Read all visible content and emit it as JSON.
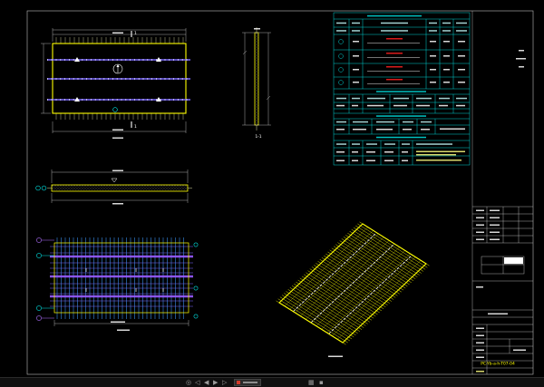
{
  "colors": {
    "background": "#000000",
    "outline": "#ffff00",
    "table": "#00e5e5",
    "rebar_purple": "#7d6bff",
    "rebar_blue": "#3f9cff",
    "accent_red": "#ff2020",
    "frame": "#bdbdbd",
    "text": "#ffffff"
  },
  "plan_view": {
    "section_mark_top": "1",
    "section_mark_bottom": "1"
  },
  "side_section": {
    "label": "1-1"
  },
  "title_block": {
    "drawing_code": "PC-Yb-a-h-T07-04"
  },
  "statusbar": {
    "icons": [
      {
        "name": "target-icon",
        "glyph": "◎"
      },
      {
        "name": "first-layout-icon",
        "glyph": "◁"
      },
      {
        "name": "previous-layout-icon",
        "glyph": "◀"
      },
      {
        "name": "next-layout-icon",
        "glyph": "▶"
      },
      {
        "name": "last-layout-icon",
        "glyph": "▷"
      },
      {
        "name": "grid-icon",
        "glyph": "▦"
      },
      {
        "name": "snap-icon",
        "glyph": "▪"
      }
    ]
  }
}
